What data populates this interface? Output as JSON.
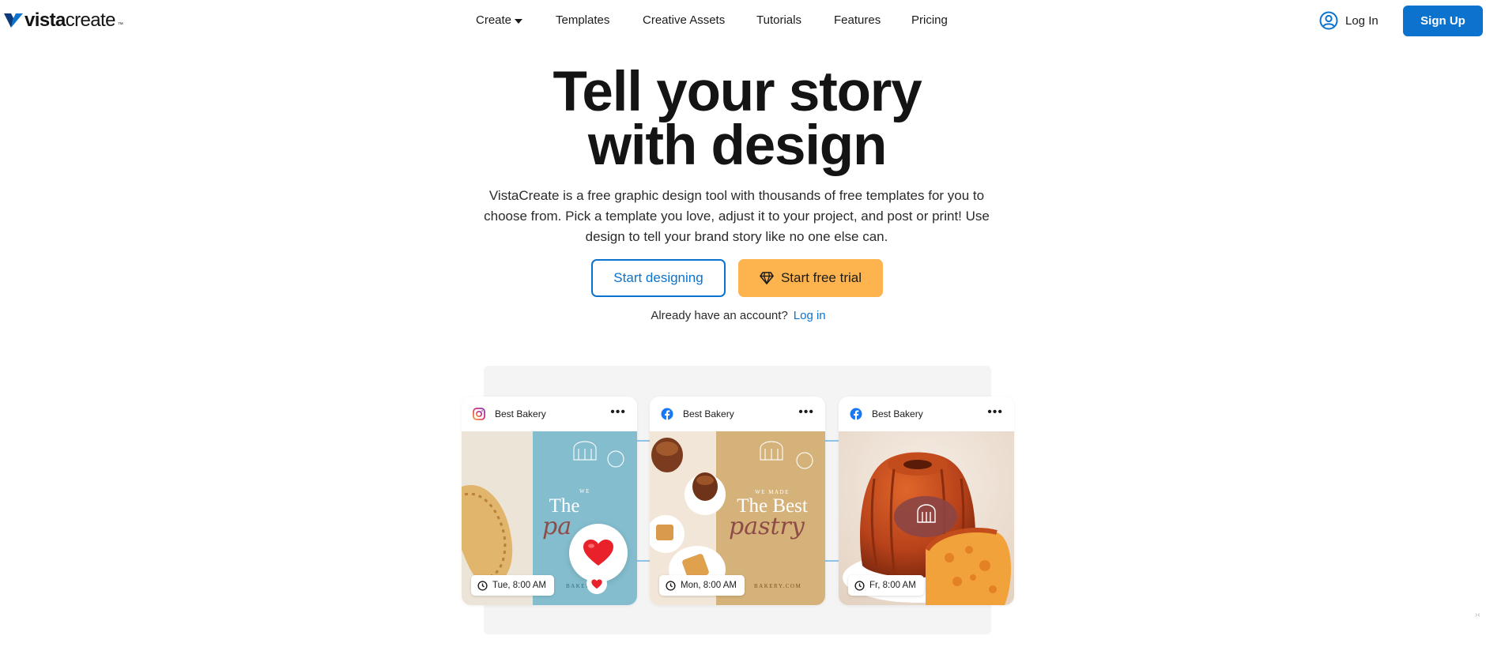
{
  "brand": {
    "logo_bold": "vista",
    "logo_light": "create",
    "logo_tm": "™",
    "primary_color": "#0b73ce",
    "accent_color": "#fdb44f"
  },
  "nav": {
    "items": [
      "Create",
      "Templates",
      "Creative Assets",
      "Tutorials",
      "Features",
      "Pricing"
    ],
    "login_label": "Log In",
    "signup_label": "Sign Up"
  },
  "hero": {
    "title_line1": "Tell your story",
    "title_line2": "with design",
    "description_line1": "VistaCreate is a free graphic design tool with thousands of free templates for you to",
    "description_line2": "choose from. Pick a template you love, adjust it to your project, and post or print! Use",
    "description_line3": "design to tell your brand story like no one else can.",
    "cta_primary": "Start designing",
    "cta_trial": "Start free trial",
    "account_prompt": "Already have an account?",
    "account_link": "Log in"
  },
  "cards": [
    {
      "network": "instagram-icon",
      "account": "Best Bakery",
      "time": "Tue, 8:00 AM",
      "poster_top": "WE",
      "poster_big": "The",
      "poster_script": "pa",
      "poster_footer": "BAKERY"
    },
    {
      "network": "facebook-icon",
      "account": "Best Bakery",
      "time": "Mon, 8:00 AM",
      "poster_top": "WE MADE",
      "poster_big": "The Best",
      "poster_script": "pastry",
      "poster_footer": "BAKERY.COM"
    },
    {
      "network": "facebook-icon",
      "account": "Best Bakery",
      "time": "Fr, 8:00 AM"
    }
  ]
}
